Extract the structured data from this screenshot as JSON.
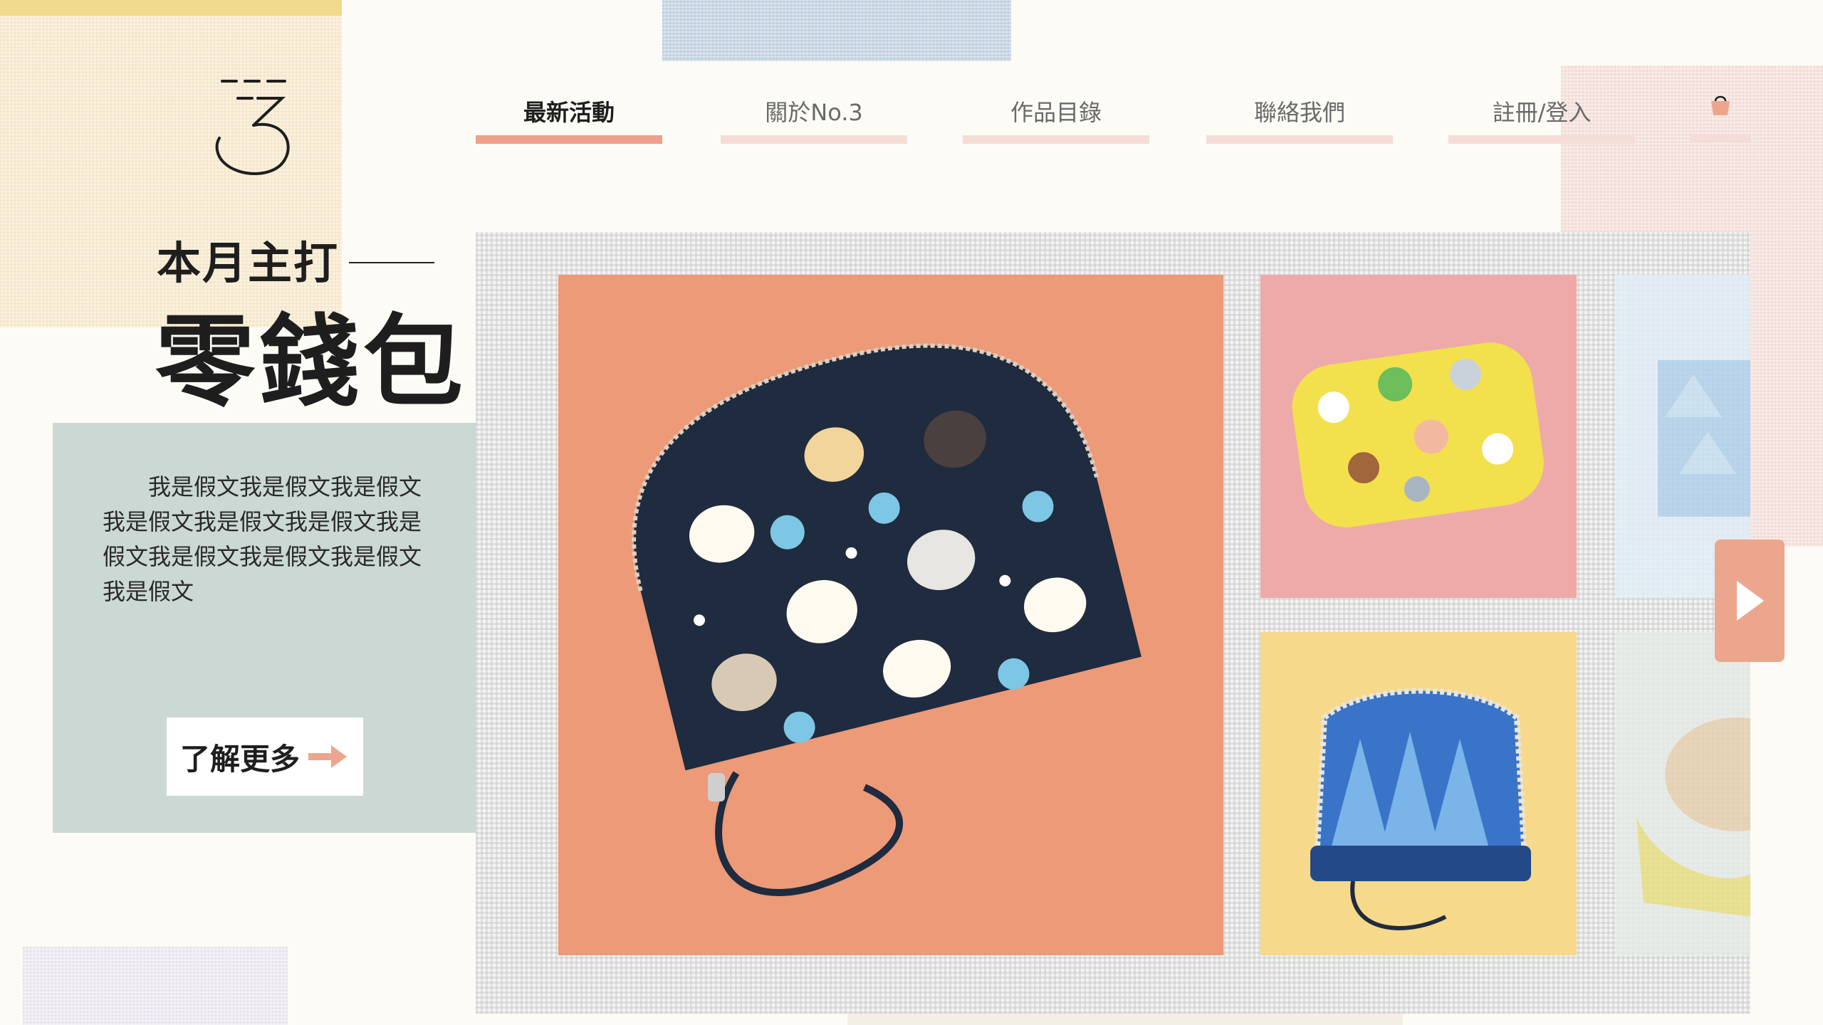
{
  "logo": {
    "glyph": "3",
    "alt": "No.3"
  },
  "nav": {
    "items": [
      {
        "label": "最新活動",
        "active": true
      },
      {
        "label": "關於No.3",
        "active": false
      },
      {
        "label": "作品目錄",
        "active": false
      },
      {
        "label": "聯絡我們",
        "active": false
      },
      {
        "label": "註冊/登入",
        "active": false
      }
    ],
    "cart_icon": "shopping-bag-icon"
  },
  "hero": {
    "month_label": "本月主打",
    "headline": "零錢包",
    "description": "我是假文我是假文我是假文我是假文我是假文我是假文我是假文我是假文我是假文我是假文我是假文",
    "more_button": "了解更多",
    "more_icon": "arrow-right-icon"
  },
  "gallery": {
    "items": [
      {
        "name": "cat-print-coin-purse",
        "bg": "#ec9a78"
      },
      {
        "name": "animal-print-coin-purse",
        "bg": "#eeaaa8"
      },
      {
        "name": "accordion-card-purse",
        "bg": "#f6d98a"
      },
      {
        "name": "blue-purse-peek",
        "bg": "#e2edf7"
      },
      {
        "name": "yellow-purse-peek",
        "bg": "#e6ebe7"
      }
    ],
    "next_icon": "play-arrow-icon"
  },
  "colors": {
    "accent": "#eea08a",
    "nav_underline": "#f4ddd6",
    "desc_box": "#cbd8d3",
    "next_button": "#eca68d"
  }
}
